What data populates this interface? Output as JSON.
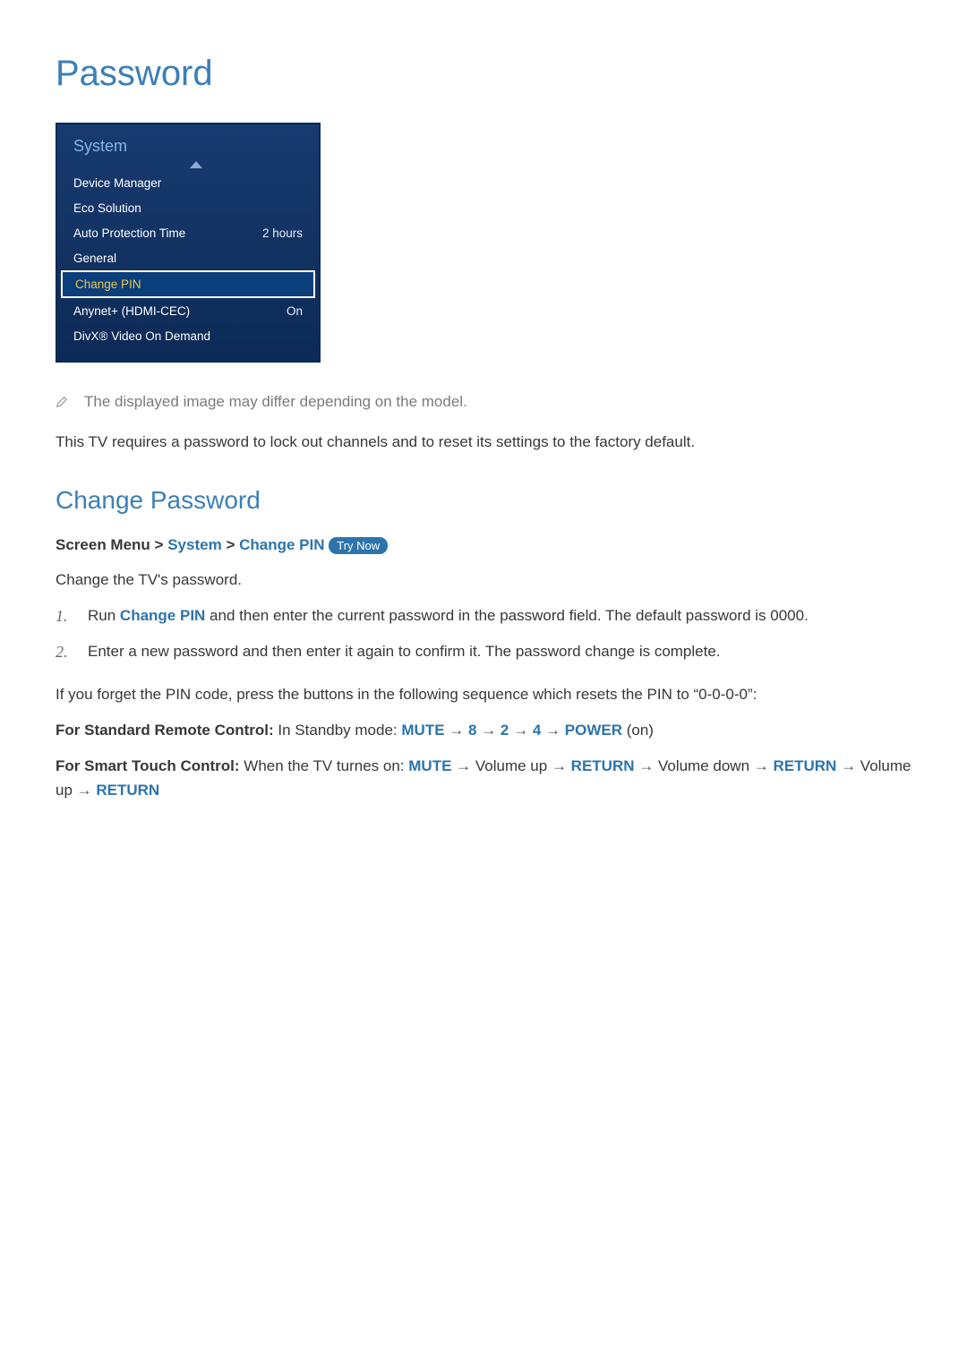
{
  "page_title": "Password",
  "menu": {
    "title": "System",
    "items": [
      {
        "label": "Device Manager",
        "value": ""
      },
      {
        "label": "Eco Solution",
        "value": ""
      },
      {
        "label": "Auto Protection Time",
        "value": "2 hours"
      },
      {
        "label": "General",
        "value": ""
      },
      {
        "label": "Change PIN",
        "value": "",
        "selected": true
      },
      {
        "label": "Anynet+ (HDMI-CEC)",
        "value": "On"
      },
      {
        "label": "DivX® Video On Demand",
        "value": ""
      }
    ]
  },
  "note": "The displayed image may differ depending on the model.",
  "intro_paragraph": "This TV requires a password to lock out channels and to reset its settings to the factory default.",
  "section_title": "Change Password",
  "breadcrumb": {
    "prefix": "Screen Menu",
    "sep": ">",
    "part1": "System",
    "part2": "Change PIN",
    "badge": "Try Now"
  },
  "change_intro": "Change the TV's password.",
  "steps": [
    {
      "num": "1.",
      "prefix": "Run ",
      "highlighted": "Change PIN",
      "rest": " and then enter the current password in the password field. The default password is 0000."
    },
    {
      "num": "2.",
      "prefix": "",
      "highlighted": "",
      "rest": "Enter a new password and then enter it again to confirm it. The password change is complete."
    }
  ],
  "reset_note": "If you forget the PIN code, press the buttons in the following sequence which resets the PIN to “0-0-0-0”:",
  "sequences": {
    "std": {
      "label": "For Standard Remote Control:",
      "prefix": " In Standby mode: ",
      "parts_html": [
        "MUTE",
        " → ",
        "8",
        " → ",
        "2",
        " → ",
        "4",
        " → ",
        "POWER",
        " (on)"
      ]
    },
    "touch": {
      "label": "For Smart Touch Control:",
      "prefix": " When the TV turnes on: ",
      "parts_html": [
        "MUTE",
        " → ",
        "Volume up",
        " → ",
        "RETURN",
        " → ",
        "Volume down",
        " → ",
        "RETURN",
        " → ",
        "Volume up",
        " → ",
        "RETURN"
      ]
    }
  }
}
